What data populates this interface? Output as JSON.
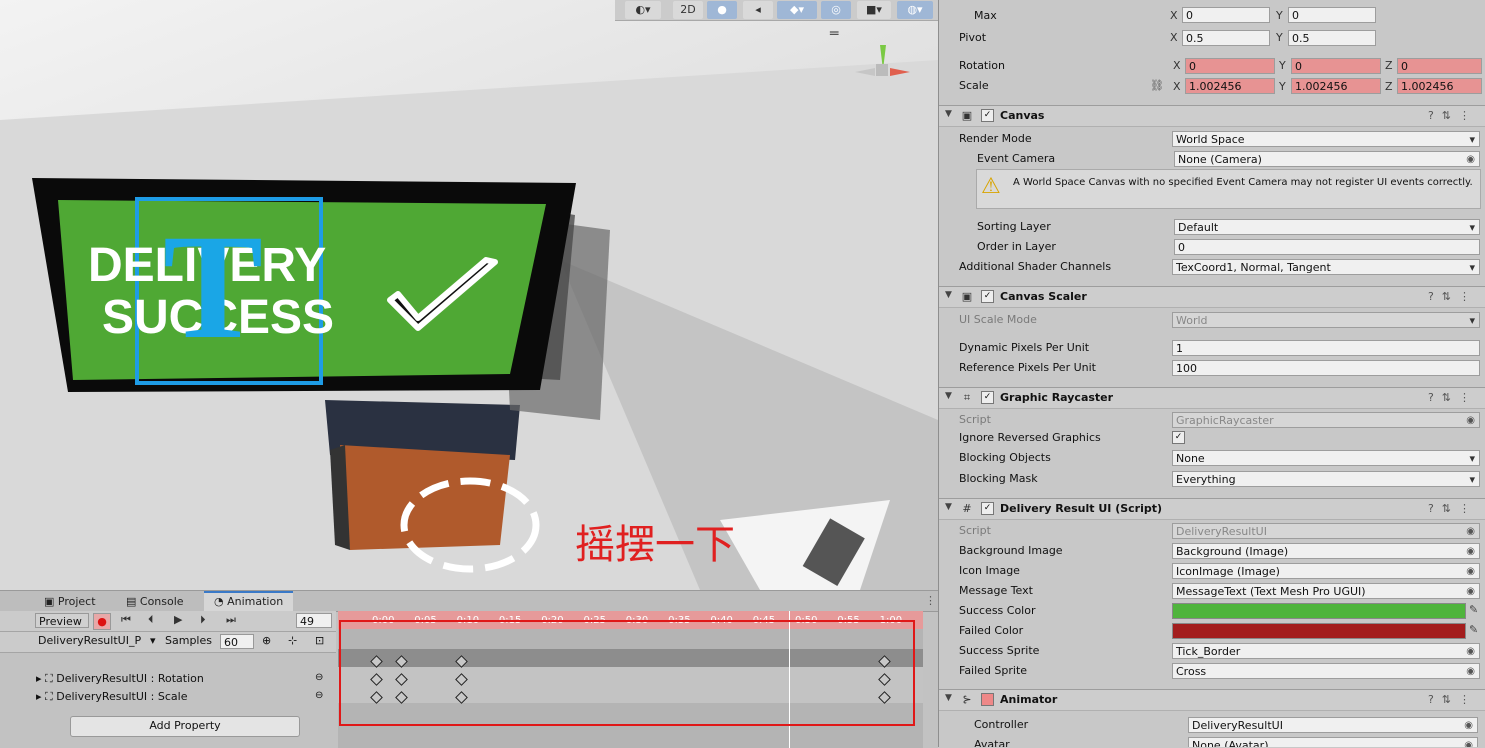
{
  "scene": {
    "toolbar": {
      "mode_2d": "2D"
    },
    "sign": {
      "line1": "DELIVERY",
      "line2": "SUCCESS",
      "glyph": "T"
    },
    "annotation": "摇摆一下"
  },
  "animation": {
    "tabs": [
      {
        "label": "Project"
      },
      {
        "label": "Console"
      },
      {
        "label": "Animation"
      }
    ],
    "preview_label": "Preview",
    "frame": "49",
    "clip": "DeliveryResultUI_P",
    "samples_label": "Samples",
    "samples": "60",
    "properties": [
      {
        "label": "DeliveryResultUI : Rotation"
      },
      {
        "label": "DeliveryResultUI : Scale"
      }
    ],
    "add_property": "Add Property",
    "ruler_ticks": [
      "0:00",
      "0:05",
      "0:10",
      "0:15",
      "0:20",
      "0:25",
      "0:30",
      "0:35",
      "0:40",
      "0:45",
      "0:50",
      "0:55",
      "1:00"
    ],
    "keyframe_times": [
      "0:00",
      "0:03",
      "0:10",
      "1:00"
    ],
    "playhead_time": "0:49"
  },
  "inspector": {
    "rect": {
      "max_label": "Max",
      "max_x": "0",
      "max_y": "0",
      "pivot_label": "Pivot",
      "pivot_x": "0.5",
      "pivot_y": "0.5",
      "rotation_label": "Rotation",
      "rot_x": "0",
      "rot_y": "0",
      "rot_z": "0",
      "scale_label": "Scale",
      "scale_x": "1.002456",
      "scale_y": "1.002456",
      "scale_z": "1.002456"
    },
    "axis": {
      "x": "X",
      "y": "Y",
      "z": "Z"
    },
    "canvas": {
      "title": "Canvas",
      "render_mode_label": "Render Mode",
      "render_mode": "World Space",
      "event_camera_label": "Event Camera",
      "event_camera": "None (Camera)",
      "warning": "A World Space Canvas with no specified Event Camera may not register UI events correctly.",
      "sorting_layer_label": "Sorting Layer",
      "sorting_layer": "Default",
      "order_label": "Order in Layer",
      "order": "0",
      "shader_label": "Additional Shader Channels",
      "shader": "TexCoord1, Normal, Tangent"
    },
    "canvas_scaler": {
      "title": "Canvas Scaler",
      "mode_label": "UI Scale Mode",
      "mode": "World",
      "dpu_label": "Dynamic Pixels Per Unit",
      "dpu": "1",
      "rppu_label": "Reference Pixels Per Unit",
      "rppu": "100"
    },
    "raycaster": {
      "title": "Graphic Raycaster",
      "script_label": "Script",
      "script": "GraphicRaycaster",
      "ignore_label": "Ignore Reversed Graphics",
      "blocking_label": "Blocking Objects",
      "blocking": "None",
      "mask_label": "Blocking Mask",
      "mask": "Everything"
    },
    "delivery": {
      "title": "Delivery Result UI (Script)",
      "script_label": "Script",
      "script": "DeliveryResultUI",
      "bg_label": "Background Image",
      "bg": "Background (Image)",
      "icon_label": "Icon Image",
      "icon": "IconImage (Image)",
      "msg_label": "Message Text",
      "msg": "MessageText (Text Mesh Pro UGUI)",
      "success_color_label": "Success Color",
      "success_color": "#4fb43c",
      "failed_color_label": "Failed Color",
      "failed_color": "#a31d1d",
      "success_sprite_label": "Success Sprite",
      "success_sprite": "Tick_Border",
      "failed_sprite_label": "Failed Sprite",
      "failed_sprite": "Cross"
    },
    "animator": {
      "title": "Animator",
      "controller_label": "Controller",
      "controller": "DeliveryResultUI",
      "avatar_label": "Avatar",
      "avatar": "None (Avatar)"
    }
  }
}
